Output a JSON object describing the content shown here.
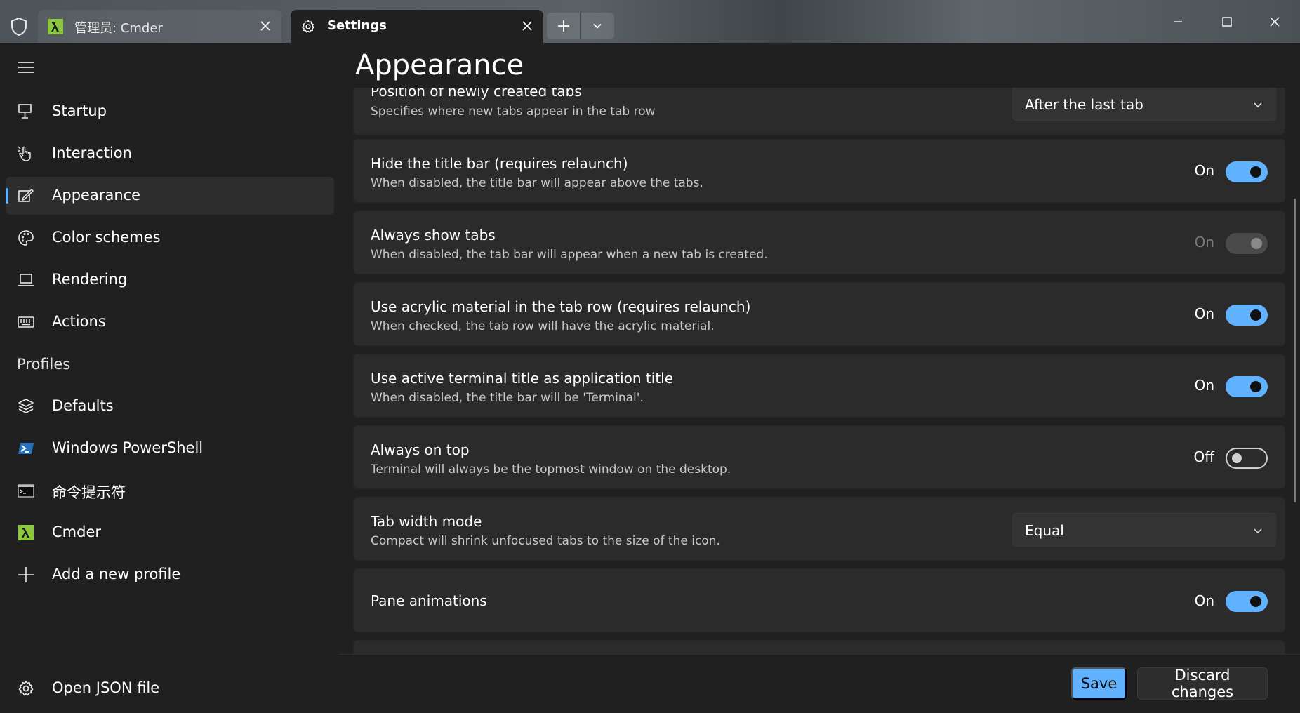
{
  "titlebar": {
    "tabs": [
      {
        "label": "管理员: Cmder",
        "icon": "lambda-icon"
      },
      {
        "label": "Settings",
        "icon": "gear-icon"
      }
    ]
  },
  "sidebar": {
    "items": [
      {
        "label": "Startup",
        "icon": "monitor-stand-icon"
      },
      {
        "label": "Interaction",
        "icon": "hand-pointer-icon"
      },
      {
        "label": "Appearance",
        "icon": "pen-edit-icon",
        "selected": true
      },
      {
        "label": "Color schemes",
        "icon": "palette-icon"
      },
      {
        "label": "Rendering",
        "icon": "laptop-icon"
      },
      {
        "label": "Actions",
        "icon": "keyboard-icon"
      }
    ],
    "profiles_header": "Profiles",
    "profiles": [
      {
        "label": "Defaults",
        "icon": "layers-icon"
      },
      {
        "label": "Windows PowerShell",
        "icon": "powershell-icon"
      },
      {
        "label": "命令提示符",
        "icon": "cmd-icon"
      },
      {
        "label": "Cmder",
        "icon": "lambda-icon"
      },
      {
        "label": "Add a new profile",
        "icon": "plus-icon"
      }
    ],
    "open_json": {
      "label": "Open JSON file",
      "icon": "gear-icon"
    }
  },
  "main": {
    "title": "Appearance",
    "settings": [
      {
        "title": "Position of newly created tabs",
        "desc": "Specifies where new tabs appear in the tab row",
        "control": "select",
        "value": "After the last tab"
      },
      {
        "title": "Hide the title bar (requires relaunch)",
        "desc": "When disabled, the title bar will appear above the tabs.",
        "control": "toggle",
        "state": "On",
        "on": true
      },
      {
        "title": "Always show tabs",
        "desc": "When disabled, the tab bar will appear when a new tab is created.",
        "control": "toggle",
        "state": "On",
        "on": true,
        "disabled": true
      },
      {
        "title": "Use acrylic material in the tab row (requires relaunch)",
        "desc": "When checked, the tab row will have the acrylic material.",
        "control": "toggle",
        "state": "On",
        "on": true
      },
      {
        "title": "Use active terminal title as application title",
        "desc": "When disabled, the title bar will be 'Terminal'.",
        "control": "toggle",
        "state": "On",
        "on": true
      },
      {
        "title": "Always on top",
        "desc": "Terminal will always be the topmost window on the desktop.",
        "control": "toggle",
        "state": "Off",
        "on": false
      },
      {
        "title": "Tab width mode",
        "desc": "Compact will shrink unfocused tabs to the size of the icon.",
        "control": "select",
        "value": "Equal"
      },
      {
        "title": "Pane animations",
        "control": "toggle",
        "state": "On",
        "on": true
      }
    ]
  },
  "footer": {
    "save_label": "Save",
    "discard_label": "Discard changes"
  },
  "colors": {
    "accent": "#60b2ff",
    "background": "#202020",
    "card": "#2b2b2b",
    "cmder_green": "#8dc63f",
    "powershell_blue": "#2671be"
  }
}
